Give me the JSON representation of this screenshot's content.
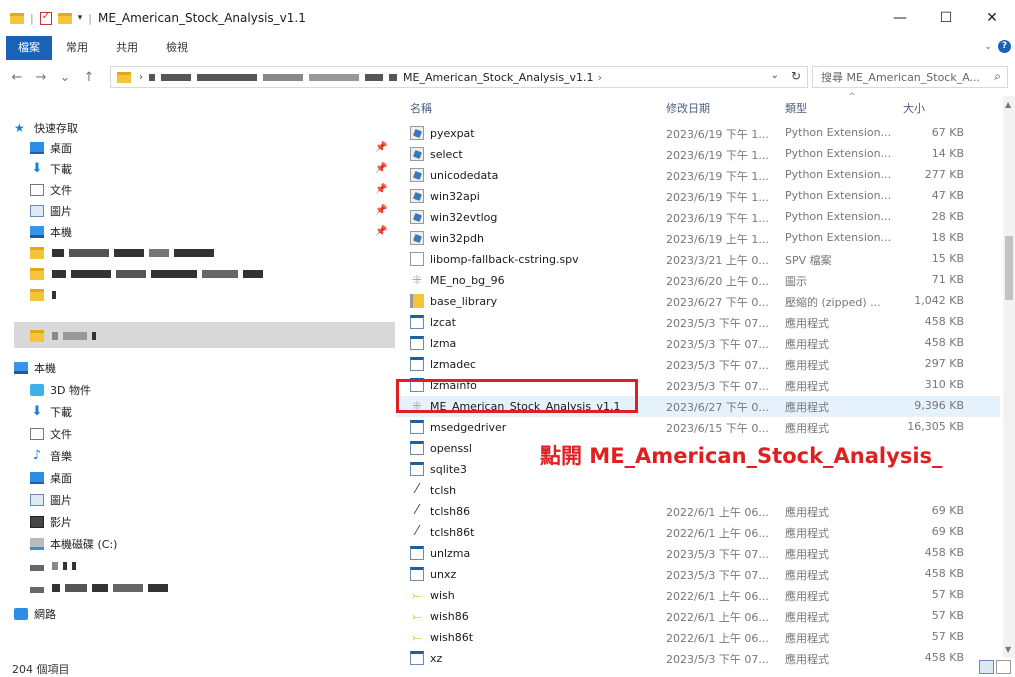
{
  "window": {
    "title": "ME_American_Stock_Analysis_v1.1",
    "minimize": "—",
    "maximize": "☐",
    "close": "✕"
  },
  "ribbon": {
    "tabs": [
      "檔案",
      "常用",
      "共用",
      "檢視"
    ],
    "collapse": "⌄",
    "help": "?"
  },
  "nav": {
    "back": "←",
    "forward": "→",
    "recent": "⌄",
    "up": "↑"
  },
  "address": {
    "crumb": "ME_American_Stock_Analysis_v1.1",
    "crumb_sep": "›",
    "dropdown": "⌄",
    "refresh": "↻"
  },
  "search": {
    "placeholder": "搜尋 ME_American_Stock_A...",
    "icon": "⌕"
  },
  "sidebar": {
    "quick_access": "快速存取",
    "quick": [
      {
        "label": "桌面",
        "icon": "desktop-icon"
      },
      {
        "label": "下載",
        "icon": "download-icon"
      },
      {
        "label": "文件",
        "icon": "documents-icon"
      },
      {
        "label": "圖片",
        "icon": "pictures-icon"
      },
      {
        "label": "本機",
        "icon": "pc-icon"
      }
    ],
    "this_pc": "本機",
    "pc_items": [
      {
        "label": "3D 物件",
        "icon": "3d-objects-icon"
      },
      {
        "label": "下載",
        "icon": "download-icon"
      },
      {
        "label": "文件",
        "icon": "documents-icon"
      },
      {
        "label": "音樂",
        "icon": "music-icon"
      },
      {
        "label": "桌面",
        "icon": "desktop-icon"
      },
      {
        "label": "圖片",
        "icon": "pictures-icon"
      },
      {
        "label": "影片",
        "icon": "videos-icon"
      },
      {
        "label": "本機磁碟 (C:)",
        "icon": "local-disk-icon"
      }
    ],
    "network": "網路",
    "pin": "📌"
  },
  "columns": {
    "name": "名稱",
    "date": "修改日期",
    "type": "類型",
    "size": "大小",
    "sort": "^"
  },
  "files": [
    {
      "name": "pyexpat",
      "date": "2023/6/19 下午 1...",
      "type": "Python Extension...",
      "size": "67 KB",
      "icon": "py"
    },
    {
      "name": "select",
      "date": "2023/6/19 下午 1...",
      "type": "Python Extension...",
      "size": "14 KB",
      "icon": "py"
    },
    {
      "name": "unicodedata",
      "date": "2023/6/19 下午 1...",
      "type": "Python Extension...",
      "size": "277 KB",
      "icon": "py"
    },
    {
      "name": "win32api",
      "date": "2023/6/19 下午 1...",
      "type": "Python Extension...",
      "size": "47 KB",
      "icon": "py"
    },
    {
      "name": "win32evtlog",
      "date": "2023/6/19 下午 1...",
      "type": "Python Extension...",
      "size": "28 KB",
      "icon": "py"
    },
    {
      "name": "win32pdh",
      "date": "2023/6/19 上午 1...",
      "type": "Python Extension...",
      "size": "18 KB",
      "icon": "py"
    },
    {
      "name": "libomp-fallback-cstring.spv",
      "date": "2023/3/21 上午 0...",
      "type": "SPV 檔案",
      "size": "15 KB",
      "icon": "blank"
    },
    {
      "name": "ME_no_bg_96",
      "date": "2023/6/20 上午 0...",
      "type": "圖示",
      "size": "71 KB",
      "icon": "img"
    },
    {
      "name": "base_library",
      "date": "2023/6/27 下午 0...",
      "type": "壓縮的 (zipped) ...",
      "size": "1,042 KB",
      "icon": "zip"
    },
    {
      "name": "lzcat",
      "date": "2023/5/3 下午 07...",
      "type": "應用程式",
      "size": "458 KB",
      "icon": "exe"
    },
    {
      "name": "lzma",
      "date": "2023/5/3 下午 07...",
      "type": "應用程式",
      "size": "458 KB",
      "icon": "exe"
    },
    {
      "name": "lzmadec",
      "date": "2023/5/3 下午 07...",
      "type": "應用程式",
      "size": "297 KB",
      "icon": "exe"
    },
    {
      "name": "lzmainfo",
      "date": "2023/5/3 下午 07...",
      "type": "應用程式",
      "size": "310 KB",
      "icon": "exe"
    },
    {
      "name": "ME_American_Stock_Analysis_v1.1",
      "date": "2023/6/27 下午 0...",
      "type": "應用程式",
      "size": "9,396 KB",
      "icon": "img",
      "highlight": true
    },
    {
      "name": "msedgedriver",
      "date": "2023/6/15 下午 0...",
      "type": "應用程式",
      "size": "16,305 KB",
      "icon": "exe"
    },
    {
      "name": "openssl",
      "date": "",
      "type": "",
      "size": "",
      "icon": "exe"
    },
    {
      "name": "sqlite3",
      "date": "",
      "type": "",
      "size": "",
      "icon": "exe"
    },
    {
      "name": "tclsh",
      "date": "",
      "type": "",
      "size": "",
      "icon": "tcl"
    },
    {
      "name": "tclsh86",
      "date": "2022/6/1 上午 06...",
      "type": "應用程式",
      "size": "69 KB",
      "icon": "tcl"
    },
    {
      "name": "tclsh86t",
      "date": "2022/6/1 上午 06...",
      "type": "應用程式",
      "size": "69 KB",
      "icon": "tcl"
    },
    {
      "name": "unlzma",
      "date": "2023/5/3 下午 07...",
      "type": "應用程式",
      "size": "458 KB",
      "icon": "exe"
    },
    {
      "name": "unxz",
      "date": "2023/5/3 下午 07...",
      "type": "應用程式",
      "size": "458 KB",
      "icon": "exe"
    },
    {
      "name": "wish",
      "date": "2022/6/1 上午 06...",
      "type": "應用程式",
      "size": "57 KB",
      "icon": "wish"
    },
    {
      "name": "wish86",
      "date": "2022/6/1 上午 06...",
      "type": "應用程式",
      "size": "57 KB",
      "icon": "wish"
    },
    {
      "name": "wish86t",
      "date": "2022/6/1 上午 06...",
      "type": "應用程式",
      "size": "57 KB",
      "icon": "wish"
    },
    {
      "name": "xz",
      "date": "2023/5/3 下午 07...",
      "type": "應用程式",
      "size": "458 KB",
      "icon": "exe"
    }
  ],
  "annotation": "點開 ME_American_Stock_Analysis_",
  "status": {
    "count": "204 個項目"
  },
  "colors": {
    "accent": "#1a62b8",
    "annotation": "#e02020",
    "highlight": "#e5f1fb"
  }
}
